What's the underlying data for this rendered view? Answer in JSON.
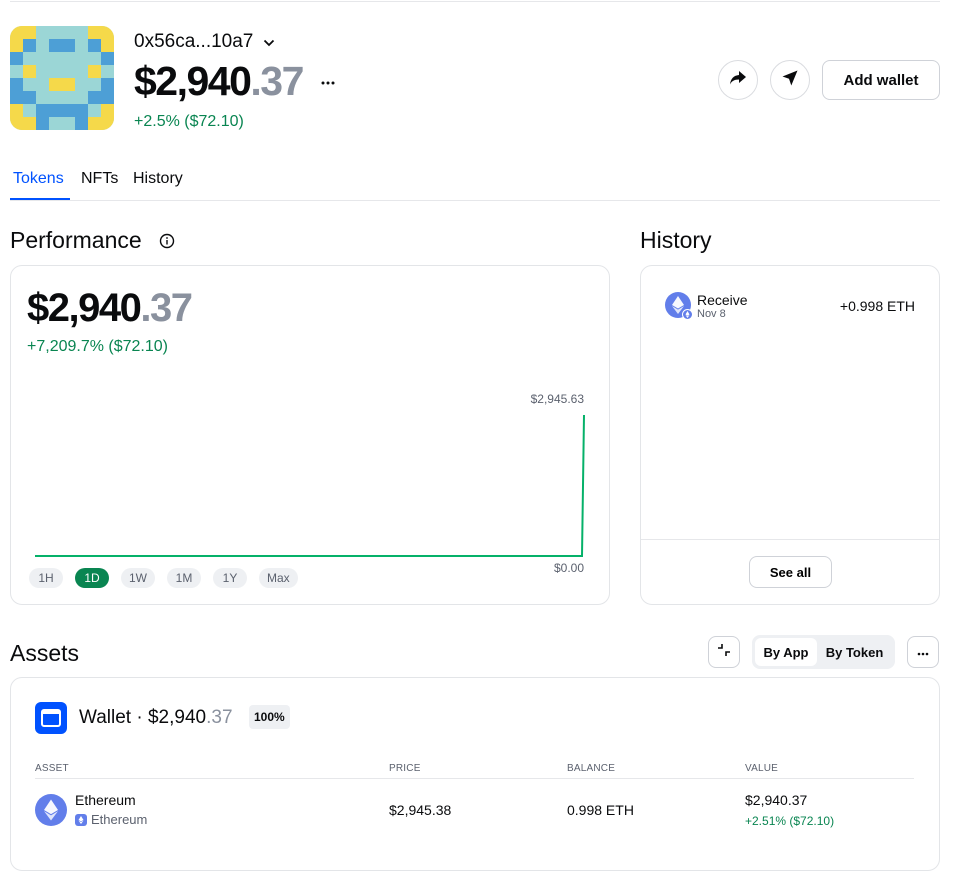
{
  "header": {
    "address": "0x56ca...10a7",
    "balance_int": "$2,940",
    "balance_dec": ".37",
    "change": "+2.5% ($72.10)",
    "add_wallet_label": "Add wallet"
  },
  "tabs": [
    {
      "label": "Tokens",
      "active": true
    },
    {
      "label": "NFTs",
      "active": false
    },
    {
      "label": "History",
      "active": false
    }
  ],
  "performance": {
    "title": "Performance",
    "balance_int": "$2,940",
    "balance_dec": ".37",
    "change": "+7,209.7% ($72.10)",
    "ranges": [
      {
        "label": "1H",
        "active": false
      },
      {
        "label": "1D",
        "active": true
      },
      {
        "label": "1W",
        "active": false
      },
      {
        "label": "1M",
        "active": false
      },
      {
        "label": "1Y",
        "active": false
      },
      {
        "label": "Max",
        "active": false
      }
    ]
  },
  "chart_data": {
    "type": "line",
    "series": [
      {
        "values": [
          0,
          0,
          0,
          0,
          0,
          0,
          0,
          0,
          0,
          0,
          0,
          0,
          0,
          0,
          0,
          0,
          0,
          0,
          0,
          0,
          0,
          0,
          0,
          0,
          2945.63
        ]
      }
    ],
    "max_label": "$2,945.63",
    "min_label": "$0.00",
    "ylim": [
      0,
      2945.63
    ],
    "color": "#05b169"
  },
  "history": {
    "title": "History",
    "items": [
      {
        "title": "Receive",
        "date": "Nov 8",
        "amount": "+0.998 ETH"
      }
    ],
    "see_all_label": "See all"
  },
  "assets": {
    "title": "Assets",
    "toggle": [
      {
        "label": "By App",
        "active": true
      },
      {
        "label": "By Token",
        "active": false
      }
    ],
    "wallet": {
      "name": "Wallet",
      "sep": " · ",
      "value_int": "$2,940",
      "value_dec": ".37",
      "percent": "100%"
    },
    "columns": [
      "ASSET",
      "PRICE",
      "BALANCE",
      "VALUE"
    ],
    "rows": [
      {
        "name": "Ethereum",
        "network": "Ethereum",
        "price": "$2,945.38",
        "balance": "0.998 ETH",
        "value": "$2,940.37",
        "change": "+2.51% ($72.10)"
      }
    ]
  },
  "colors": {
    "accent": "#0052ff",
    "positive": "#098551",
    "eth": "#627eea"
  }
}
